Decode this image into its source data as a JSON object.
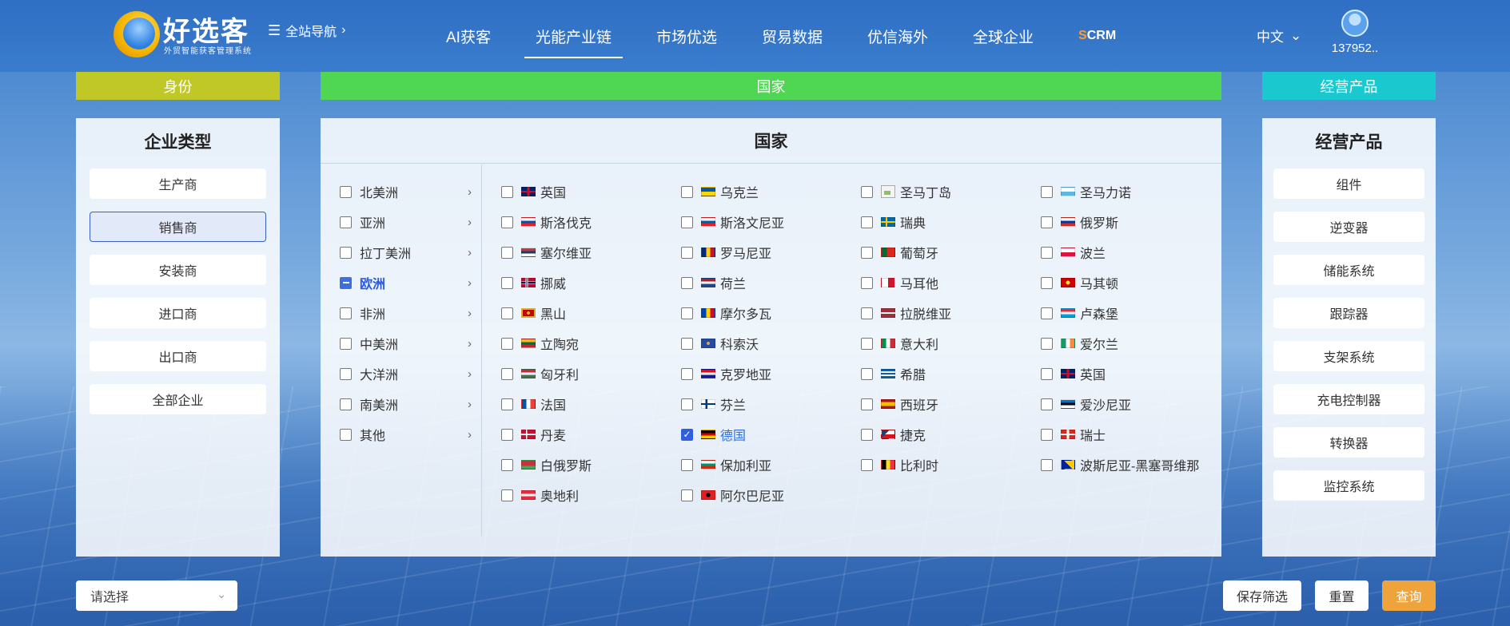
{
  "header": {
    "logo_title": "好选客",
    "logo_subtitle": "外贸智能获客管理系统",
    "site_nav_label": "全站导航",
    "menu": [
      {
        "label": "AI获客"
      },
      {
        "label": "光能产业链",
        "active": true
      },
      {
        "label": "市场优选"
      },
      {
        "label": "贸易数据"
      },
      {
        "label": "优信海外"
      },
      {
        "label": "全球企业"
      }
    ],
    "scrm_s": "S",
    "scrm_rest": "CRM",
    "language": "中文",
    "username": "137952.."
  },
  "categories": {
    "identity": "身份",
    "country": "国家",
    "product": "经营产品"
  },
  "identity_panel": {
    "title": "企业类型",
    "options": [
      {
        "label": "生产商"
      },
      {
        "label": "销售商",
        "selected": true
      },
      {
        "label": "安装商"
      },
      {
        "label": "进口商"
      },
      {
        "label": "出口商"
      },
      {
        "label": "全部企业"
      }
    ]
  },
  "country_panel": {
    "title": "国家",
    "continents": [
      {
        "label": "北美洲"
      },
      {
        "label": "亚洲"
      },
      {
        "label": "拉丁美洲"
      },
      {
        "label": "欧洲",
        "active": true
      },
      {
        "label": "非洲"
      },
      {
        "label": "中美洲"
      },
      {
        "label": "大洋洲"
      },
      {
        "label": "南美洲"
      },
      {
        "label": "其他"
      }
    ],
    "countries": [
      [
        "英国",
        "乌克兰",
        "圣马丁岛",
        "圣马力诺"
      ],
      [
        "斯洛伐克",
        "斯洛文尼亚",
        "瑞典",
        "俄罗斯"
      ],
      [
        "塞尔维亚",
        "罗马尼亚",
        "葡萄牙",
        "波兰"
      ],
      [
        "挪威",
        "荷兰",
        "马耳他",
        "马其顿"
      ],
      [
        "黑山",
        "摩尔多瓦",
        "拉脱维亚",
        "卢森堡"
      ],
      [
        "立陶宛",
        "科索沃",
        "意大利",
        "爱尔兰"
      ],
      [
        "匈牙利",
        "克罗地亚",
        "希腊",
        "英国"
      ],
      [
        "法国",
        "芬兰",
        "西班牙",
        "爱沙尼亚"
      ],
      [
        "丹麦",
        "德国",
        "捷克",
        "瑞士"
      ],
      [
        "白俄罗斯",
        "保加利亚",
        "比利时",
        "波斯尼亚-黑塞哥维那"
      ],
      [
        "奥地利",
        "阿尔巴尼亚"
      ]
    ],
    "selected_country": "德国"
  },
  "product_panel": {
    "title": "经营产品",
    "options": [
      {
        "label": "组件"
      },
      {
        "label": "逆变器"
      },
      {
        "label": "储能系统"
      },
      {
        "label": "跟踪器"
      },
      {
        "label": "支架系统"
      },
      {
        "label": "充电控制器"
      },
      {
        "label": "转换器"
      },
      {
        "label": "监控系统"
      }
    ]
  },
  "footer": {
    "select_placeholder": "请选择",
    "save_label": "保存筛选",
    "reset_label": "重置",
    "query_label": "查询"
  },
  "colors": {
    "identity_bar": "#bfc827",
    "country_bar": "#4fd652",
    "product_bar": "#1ac8cf",
    "query_button": "#eea33b",
    "selection_blue": "#2f5fe0"
  }
}
